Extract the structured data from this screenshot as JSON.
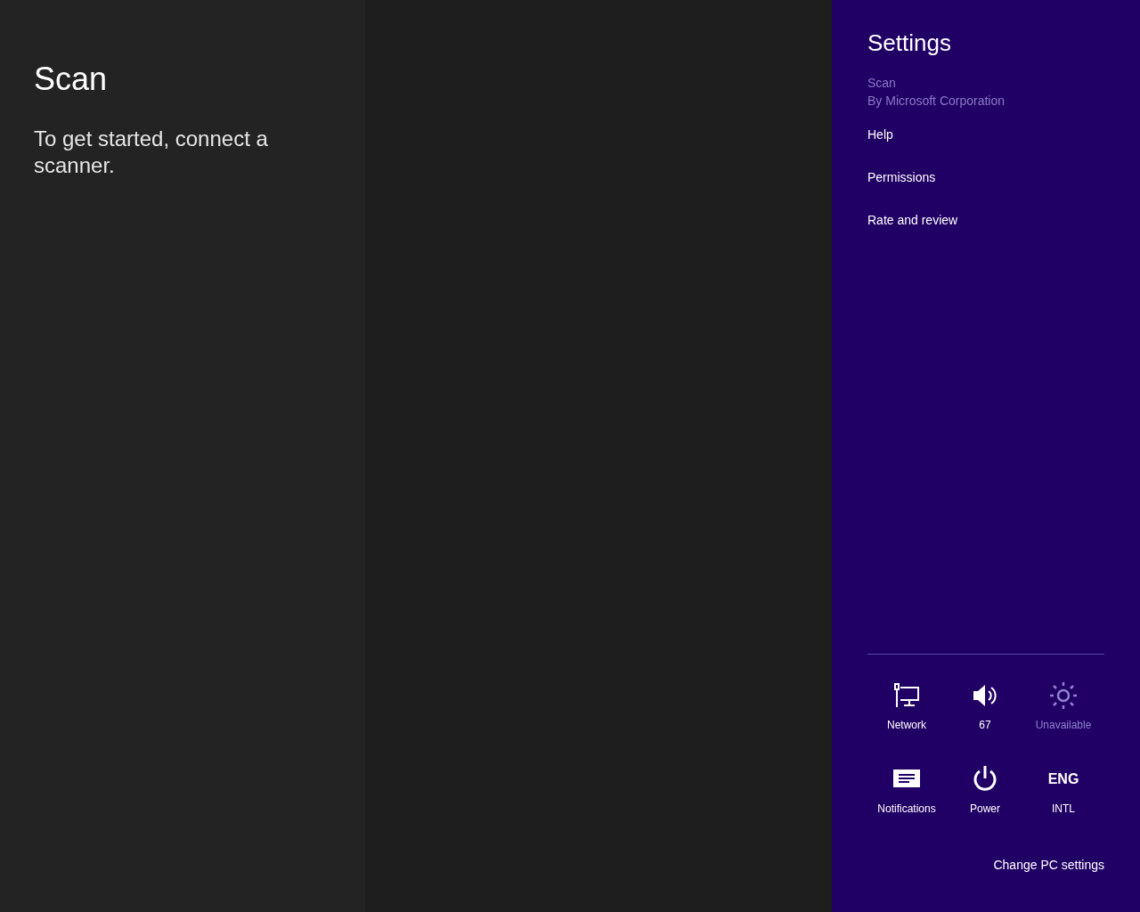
{
  "app": {
    "title": "Scan",
    "message": "To get started, connect a scanner."
  },
  "settings_pane": {
    "title": "Settings",
    "app_name": "Scan",
    "publisher": "By Microsoft Corporation",
    "items": [
      {
        "label": "Help"
      },
      {
        "label": "Permissions"
      },
      {
        "label": "Rate and review"
      }
    ],
    "quick_tiles": [
      {
        "kind": "network",
        "label": "Network",
        "disabled": false
      },
      {
        "kind": "volume",
        "label": "67",
        "disabled": false
      },
      {
        "kind": "brightness",
        "label": "Unavailable",
        "disabled": true
      },
      {
        "kind": "notifications",
        "label": "Notifications",
        "disabled": false
      },
      {
        "kind": "power",
        "label": "Power",
        "disabled": false
      },
      {
        "kind": "language",
        "code": "ENG",
        "label": "INTL",
        "disabled": false
      }
    ],
    "footer_link": "Change PC settings"
  }
}
